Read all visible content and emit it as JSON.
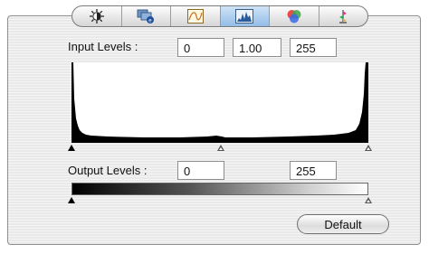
{
  "tabs": [
    {
      "icon": "brightness-icon",
      "active": false
    },
    {
      "icon": "display-profile-icon",
      "active": false
    },
    {
      "icon": "curve-icon",
      "active": false
    },
    {
      "icon": "histogram-icon",
      "active": true
    },
    {
      "icon": "color-balance-icon",
      "active": false
    },
    {
      "icon": "color-picker-icon",
      "active": false
    }
  ],
  "input_levels": {
    "label": "Input Levels :",
    "black": "0",
    "gamma": "1.00",
    "white": "255"
  },
  "output_levels": {
    "label": "Output Levels :",
    "black": "0",
    "white": "255"
  },
  "default_button": "Default",
  "colors": {
    "active_tab": "#93bde7",
    "histogram": "#000000"
  }
}
